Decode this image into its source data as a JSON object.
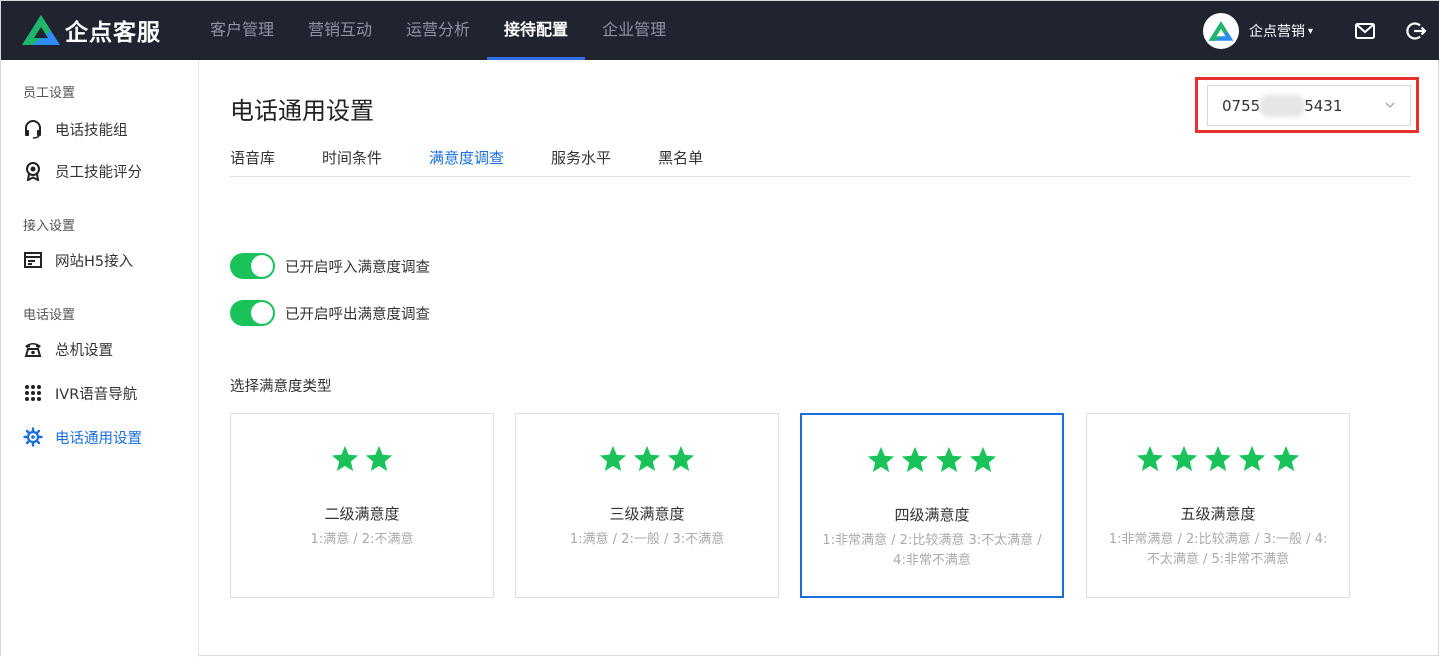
{
  "app": {
    "name": "企点客服",
    "brand_color": "#1f2430",
    "accent_color": "#1a6fe0"
  },
  "nav": {
    "items": [
      {
        "label": "客户管理",
        "active": false
      },
      {
        "label": "营销互动",
        "active": false
      },
      {
        "label": "运营分析",
        "active": false
      },
      {
        "label": "接待配置",
        "active": true
      },
      {
        "label": "企业管理",
        "active": false
      }
    ]
  },
  "user": {
    "name": "企点营销",
    "caret": "▾"
  },
  "sidebar": {
    "groups": [
      {
        "title": "员工设置"
      },
      {
        "title": "接入设置"
      },
      {
        "title": "电话设置"
      }
    ],
    "items": [
      {
        "label": "电话技能组",
        "icon": "headset-icon"
      },
      {
        "label": "员工技能评分",
        "icon": "award-icon"
      },
      {
        "label": "网站H5接入",
        "icon": "web-window-icon"
      },
      {
        "label": "总机设置",
        "icon": "telephone-icon"
      },
      {
        "label": "IVR语音导航",
        "icon": "keypad-icon"
      },
      {
        "label": "电话通用设置",
        "icon": "gear-icon",
        "active": true
      }
    ]
  },
  "main": {
    "title": "电话通用设置",
    "phone_select": {
      "value_prefix": "0755",
      "value_suffix": "5431"
    },
    "tabs": [
      {
        "label": "语音库"
      },
      {
        "label": "时间条件"
      },
      {
        "label": "满意度调查",
        "active": true
      },
      {
        "label": "服务水平"
      },
      {
        "label": "黑名单"
      }
    ],
    "toggles": [
      {
        "label": "已开启呼入满意度调查",
        "on": true
      },
      {
        "label": "已开启呼出满意度调查",
        "on": true
      }
    ],
    "type_label": "选择满意度类型",
    "cards": [
      {
        "stars": 2,
        "title": "二级满意度",
        "desc": "1:满意 / 2:不满意",
        "selected": false
      },
      {
        "stars": 3,
        "title": "三级满意度",
        "desc": "1:满意 / 2:一般 / 3:不满意",
        "selected": false
      },
      {
        "stars": 4,
        "title": "四级满意度",
        "desc": "1:非常满意 / 2:比较满意 3:不太满意 / 4:非常不满意",
        "selected": true
      },
      {
        "stars": 5,
        "title": "五级满意度",
        "desc": "1:非常满意 / 2:比较满意 / 3:一般 / 4:不太满意 / 5:非常不满意",
        "selected": false
      }
    ],
    "star_color": "#19c35a",
    "switch_color": "#19c35a"
  }
}
